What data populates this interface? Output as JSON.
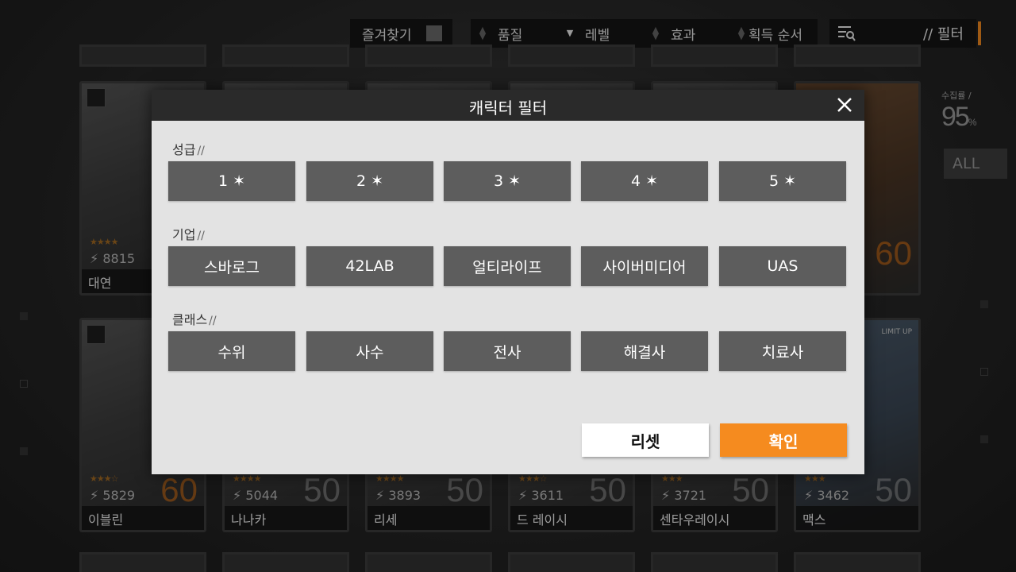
{
  "topbar": {
    "favorites_label": "즐겨찾기",
    "sort_items": [
      "품질",
      "레벨",
      "효과",
      "획득 순서"
    ],
    "filter_label": "// 필터",
    "accent_color": "#f58b1f"
  },
  "side": {
    "collection_label": "수집률 /",
    "collection_value": "95",
    "percent_sign": "%",
    "all_label": "ALL"
  },
  "cards_row2": [
    {
      "power": "5829",
      "level": "60",
      "name": "이블린",
      "stars": "★★★☆"
    },
    {
      "power": "5044",
      "level": "50",
      "name": "나나카",
      "stars": "★★★★"
    },
    {
      "power": "3893",
      "level": "50",
      "name": "리세",
      "stars": "★★★★"
    },
    {
      "power": "3611",
      "level": "50",
      "name": "드 레이시",
      "stars": "★★★☆"
    },
    {
      "power": "3721",
      "level": "50",
      "name": "센타우레이시",
      "stars": "★★★"
    },
    {
      "power": "3462",
      "level": "50",
      "name": "맥스",
      "stars": "★★★"
    }
  ],
  "card_row1_first": {
    "power": "8815",
    "name": "대연",
    "stars": "★★★★"
  },
  "card_row1_last": {
    "level": "60"
  },
  "limit_up": "LIMIT UP",
  "modal": {
    "title": "캐릭터 필터",
    "sections": [
      {
        "label": "성급",
        "options": [
          "1 ✶",
          "2 ✶",
          "3 ✶",
          "4 ✶",
          "5 ✶"
        ]
      },
      {
        "label": "기업",
        "options": [
          "스바로그",
          "42LAB",
          "얼티라이프",
          "사이버미디어",
          "UAS"
        ]
      },
      {
        "label": "클래스",
        "options": [
          "수위",
          "사수",
          "전사",
          "해결사",
          "치료사"
        ]
      }
    ],
    "section_suffix": "//",
    "reset_label": "리셋",
    "confirm_label": "확인"
  }
}
